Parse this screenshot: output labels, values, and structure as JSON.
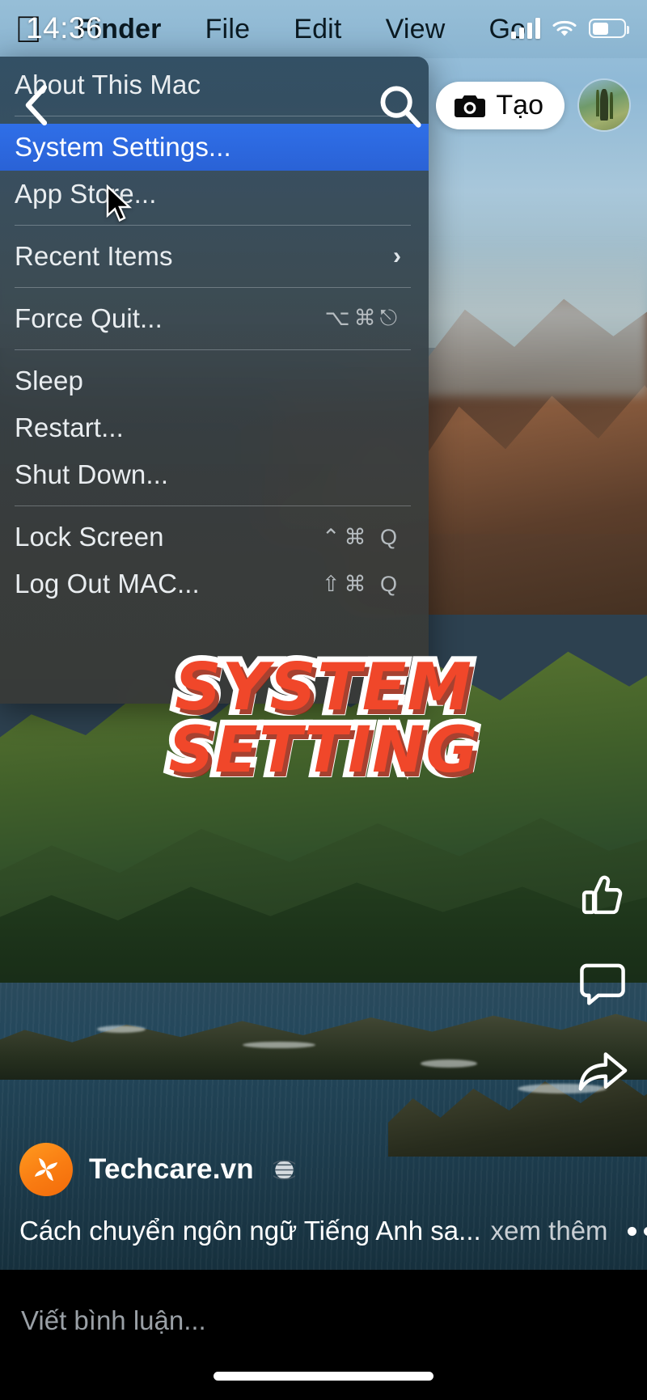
{
  "status_bar": {
    "time": "14:36",
    "cellular_icon": "signal-bars-icon",
    "wifi_icon": "wifi-icon",
    "battery_icon": "battery-icon",
    "battery_level_pct": 52
  },
  "mac_menubar": {
    "apple_logo": "apple-logo-icon",
    "items": [
      {
        "label": "Finder",
        "bold": true
      },
      {
        "label": "File",
        "bold": false
      },
      {
        "label": "Edit",
        "bold": false
      },
      {
        "label": "View",
        "bold": false
      },
      {
        "label": "Go",
        "bold": false
      }
    ]
  },
  "apple_menu": {
    "rows": [
      {
        "type": "item",
        "label": "About This Mac",
        "shortcut": "",
        "selected": false,
        "submenu": false
      },
      {
        "type": "separator"
      },
      {
        "type": "item",
        "label": "System Settings...",
        "shortcut": "",
        "selected": true,
        "submenu": false
      },
      {
        "type": "item",
        "label": "App Store...",
        "shortcut": "",
        "selected": false,
        "submenu": false
      },
      {
        "type": "separator"
      },
      {
        "type": "item",
        "label": "Recent Items",
        "shortcut": "",
        "selected": false,
        "submenu": true
      },
      {
        "type": "separator"
      },
      {
        "type": "item",
        "label": "Force Quit...",
        "shortcut": "⌥⌘⎋",
        "selected": false,
        "submenu": false
      },
      {
        "type": "separator"
      },
      {
        "type": "item",
        "label": "Sleep",
        "shortcut": "",
        "selected": false,
        "submenu": false
      },
      {
        "type": "item",
        "label": "Restart...",
        "shortcut": "",
        "selected": false,
        "submenu": false
      },
      {
        "type": "item",
        "label": "Shut Down...",
        "shortcut": "",
        "selected": false,
        "submenu": false
      },
      {
        "type": "separator"
      },
      {
        "type": "item",
        "label": "Lock Screen",
        "shortcut": "⌃⌘ Q",
        "selected": false,
        "submenu": false
      },
      {
        "type": "item",
        "label": "Log Out MAC...",
        "shortcut": "⇧⌘ Q",
        "selected": false,
        "submenu": false
      }
    ],
    "highlight_color": "#2f6fe8",
    "submenu_arrow": "›"
  },
  "fb_topbar": {
    "back_icon": "back-chevron-icon",
    "search_icon": "search-icon",
    "create_button": {
      "label": "Tạo",
      "icon": "camera-icon"
    },
    "avatar": "profile-avatar"
  },
  "sticker": {
    "line1": "SYSTEM",
    "line2": "SETTING",
    "fill_color": "#F0472A",
    "outline_color": "#FFFFFF"
  },
  "action_rail": [
    {
      "name": "like-button",
      "icon": "thumbs-up-icon"
    },
    {
      "name": "comment-button",
      "icon": "comment-bubble-icon"
    },
    {
      "name": "share-button",
      "icon": "share-arrow-icon"
    }
  ],
  "post": {
    "page_name": "Techcare.vn",
    "page_logo_color": "#F97C12",
    "privacy_icon": "globe-icon",
    "caption": "Cách chuyển ngôn ngữ Tiếng Anh sa...",
    "see_more": "xem thêm",
    "more_options_icon": "more-options-icon"
  },
  "comment_bar": {
    "placeholder": "Viết bình luận...",
    "home_indicator": "home-indicator"
  }
}
